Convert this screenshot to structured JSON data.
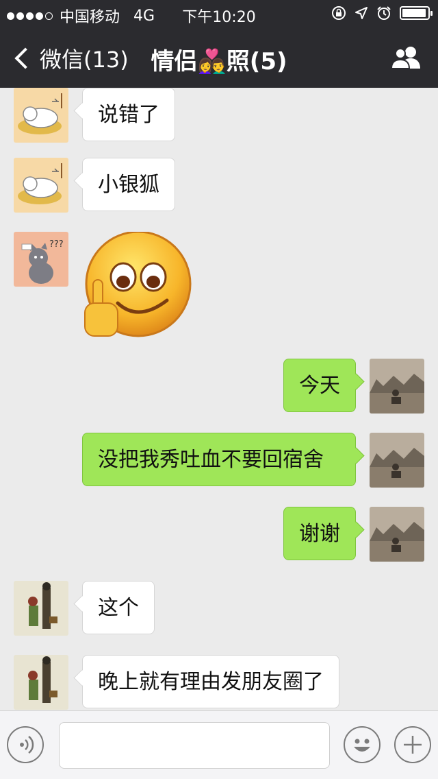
{
  "status": {
    "carrier": "中国移动",
    "network": "4G",
    "time": "下午10:20",
    "battery_level": 0.95
  },
  "header": {
    "back_label": "微信(13)",
    "title": "情侣👩‍❤️‍👨照(5)"
  },
  "messages": [
    {
      "direction": "in",
      "avatar": "sleeping-cat-avatar",
      "text": "说错了"
    },
    {
      "direction": "in",
      "avatar": "sleeping-cat-avatar",
      "text": "小银狐"
    },
    {
      "direction": "in",
      "avatar": "confused-cat-avatar",
      "sticker": "smiley-middle-finger-sticker"
    },
    {
      "direction": "out",
      "avatar": "sepia-photo-avatar",
      "text": "今天"
    },
    {
      "direction": "out",
      "avatar": "sepia-photo-avatar",
      "text": "没把我秀吐血不要回宿舍"
    },
    {
      "direction": "out",
      "avatar": "sepia-photo-avatar",
      "text": "谢谢"
    },
    {
      "direction": "in",
      "avatar": "leon-movie-avatar",
      "text": "这个"
    },
    {
      "direction": "in",
      "avatar": "leon-movie-avatar",
      "text": "晚上就有理由发朋友圈了"
    }
  ],
  "composer": {
    "value": "",
    "voice_icon": "voice-icon",
    "emoji_icon": "emoji-icon",
    "plus_icon": "plus-icon"
  },
  "colors": {
    "bar_bg": "#2b2b2f",
    "chat_bg": "#ebebeb",
    "outgoing_bubble": "#9fe658",
    "incoming_bubble": "#ffffff"
  }
}
